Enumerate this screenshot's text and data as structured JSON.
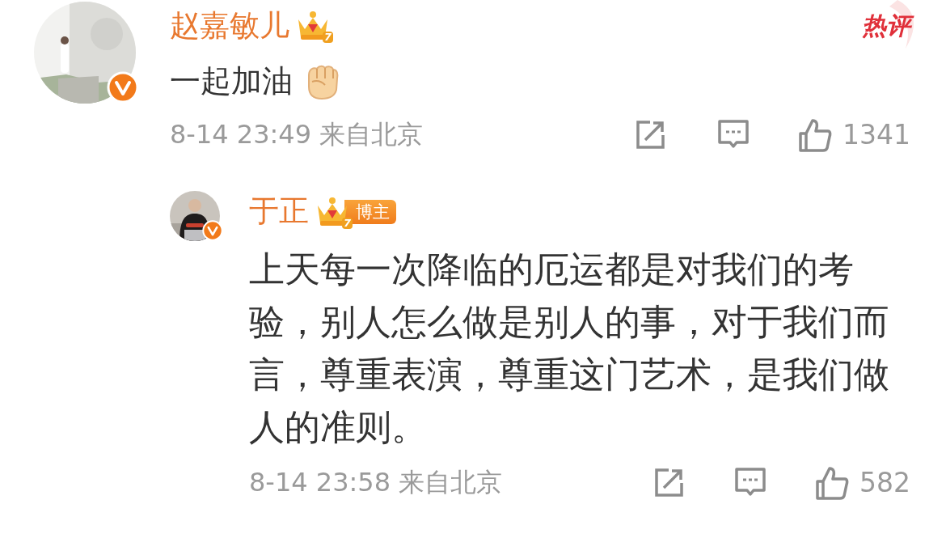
{
  "comment": {
    "author": "赵嘉敏儿",
    "rank": "7",
    "verified": true,
    "hot_label": "热评",
    "text": "一起加油",
    "time": "8-14 23:49",
    "location": "来自北京",
    "likes": "1341",
    "reply": {
      "author": "于正",
      "rank": "7",
      "tag": "博主",
      "verified": true,
      "text": "上天每一次降临的厄运都是对我们的考验，别人怎么做是别人的事，对于我们而言，尊重表演，尊重这门艺术，是我们做人的准则。",
      "time": "8-14 23:58",
      "location": "来自北京",
      "likes": "582"
    }
  }
}
